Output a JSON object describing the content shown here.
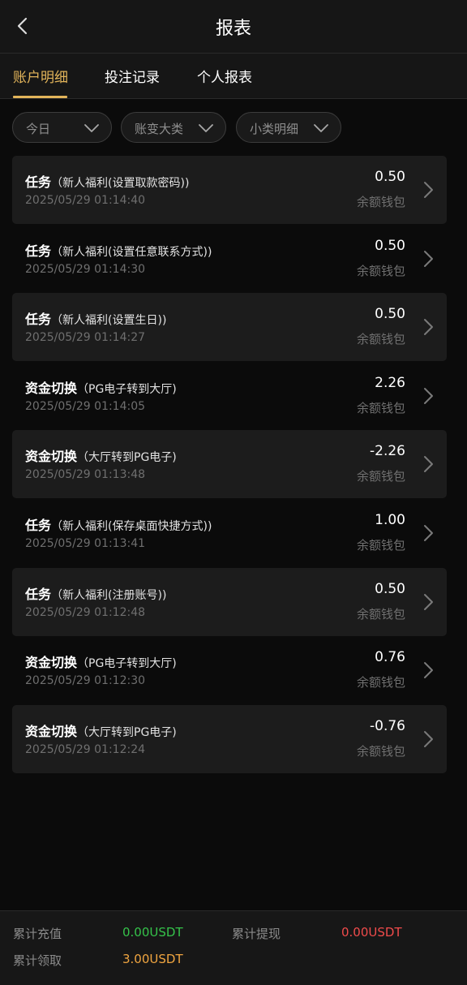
{
  "header": {
    "title": "报表",
    "back_icon": "chevron-left-icon"
  },
  "tabs": [
    {
      "label": "账户明细",
      "active": true
    },
    {
      "label": "投注记录",
      "active": false
    },
    {
      "label": "个人报表",
      "active": false
    }
  ],
  "filters": [
    {
      "label": "今日",
      "icon": "chevron-down-icon"
    },
    {
      "label": "账变大类",
      "icon": "chevron-down-icon"
    },
    {
      "label": "小类明细",
      "icon": "chevron-down-icon"
    }
  ],
  "records": [
    {
      "type": "任务",
      "detail": "（新人福利(设置取款密码))",
      "time": "2025/05/29 01:14:40",
      "amount": "0.50",
      "wallet": "余额钱包"
    },
    {
      "type": "任务",
      "detail": "（新人福利(设置任意联系方式))",
      "time": "2025/05/29 01:14:30",
      "amount": "0.50",
      "wallet": "余额钱包"
    },
    {
      "type": "任务",
      "detail": "（新人福利(设置生日))",
      "time": "2025/05/29 01:14:27",
      "amount": "0.50",
      "wallet": "余额钱包"
    },
    {
      "type": "资金切换",
      "detail": "（PG电子转到大厅)",
      "time": "2025/05/29 01:14:05",
      "amount": "2.26",
      "wallet": "余额钱包"
    },
    {
      "type": "资金切换",
      "detail": "（大厅转到PG电子)",
      "time": "2025/05/29 01:13:48",
      "amount": "-2.26",
      "wallet": "余额钱包"
    },
    {
      "type": "任务",
      "detail": "（新人福利(保存桌面快捷方式))",
      "time": "2025/05/29 01:13:41",
      "amount": "1.00",
      "wallet": "余额钱包"
    },
    {
      "type": "任务",
      "detail": "（新人福利(注册账号))",
      "time": "2025/05/29 01:12:48",
      "amount": "0.50",
      "wallet": "余额钱包"
    },
    {
      "type": "资金切换",
      "detail": "（PG电子转到大厅)",
      "time": "2025/05/29 01:12:30",
      "amount": "0.76",
      "wallet": "余额钱包"
    },
    {
      "type": "资金切换",
      "detail": "（大厅转到PG电子)",
      "time": "2025/05/29 01:12:24",
      "amount": "-0.76",
      "wallet": "余额钱包"
    }
  ],
  "footer": {
    "recharge_label": "累计充值",
    "recharge_value": "0.00USDT",
    "recharge_color": "#35c24a",
    "withdraw_label": "累计提现",
    "withdraw_value": "0.00USDT",
    "withdraw_color": "#ef4b4b",
    "claim_label": "累计领取",
    "claim_value": "3.00USDT",
    "claim_color": "#f0a540"
  },
  "colors": {
    "accent": "#e2b45a",
    "background": "#0b0b0b",
    "card": "#1c1c1c"
  }
}
